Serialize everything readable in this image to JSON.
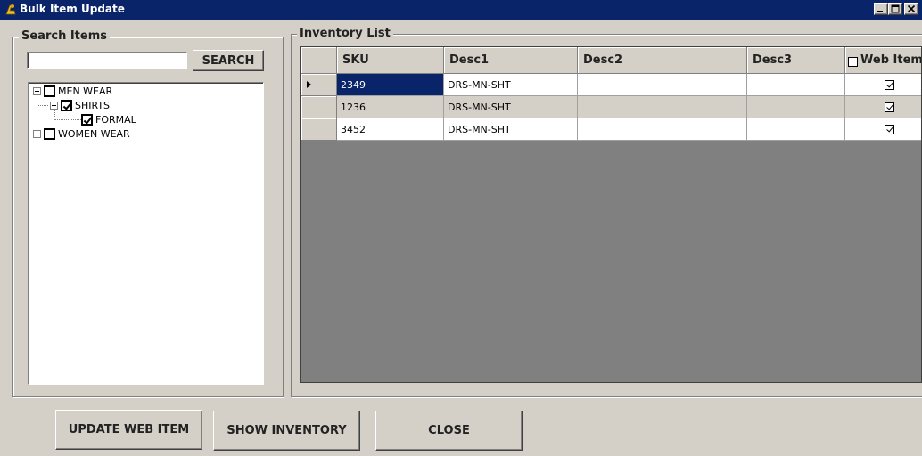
{
  "window": {
    "title": "Bulk Item Update",
    "controls": [
      "minimize-icon",
      "maximize-icon",
      "close-icon"
    ]
  },
  "search_group": {
    "title": "Search Items",
    "input_value": "",
    "search_button": "SEARCH"
  },
  "tree": [
    {
      "label": "MEN WEAR",
      "checked": false,
      "expanded": true,
      "level": 0
    },
    {
      "label": "SHIRTS",
      "checked": true,
      "expanded": true,
      "level": 1
    },
    {
      "label": "FORMAL",
      "checked": true,
      "level": 2
    },
    {
      "label": "WOMEN WEAR",
      "checked": false,
      "expanded": false,
      "level": 0
    }
  ],
  "inventory_group": {
    "title": "Inventory List"
  },
  "grid": {
    "columns": [
      "SKU",
      "Desc1",
      "Desc2",
      "Desc3",
      "Web Item"
    ],
    "rows": [
      {
        "sku": "2349",
        "desc1": "DRS-MN-SHT",
        "desc2": "",
        "desc3": "",
        "web": true,
        "selected": true
      },
      {
        "sku": "1236",
        "desc1": "DRS-MN-SHT",
        "desc2": "",
        "desc3": "",
        "web": true
      },
      {
        "sku": "3452",
        "desc1": "DRS-MN-SHT",
        "desc2": "",
        "desc3": "",
        "web": true
      }
    ],
    "selected_color": "#0a246a",
    "alt_row_color": "#d4d0c8",
    "empty_area_color": "#808080"
  },
  "buttons": {
    "update_web_item": "UPDATE WEB ITEM",
    "show_inventory": "SHOW INVENTORY",
    "close": "CLOSE"
  }
}
